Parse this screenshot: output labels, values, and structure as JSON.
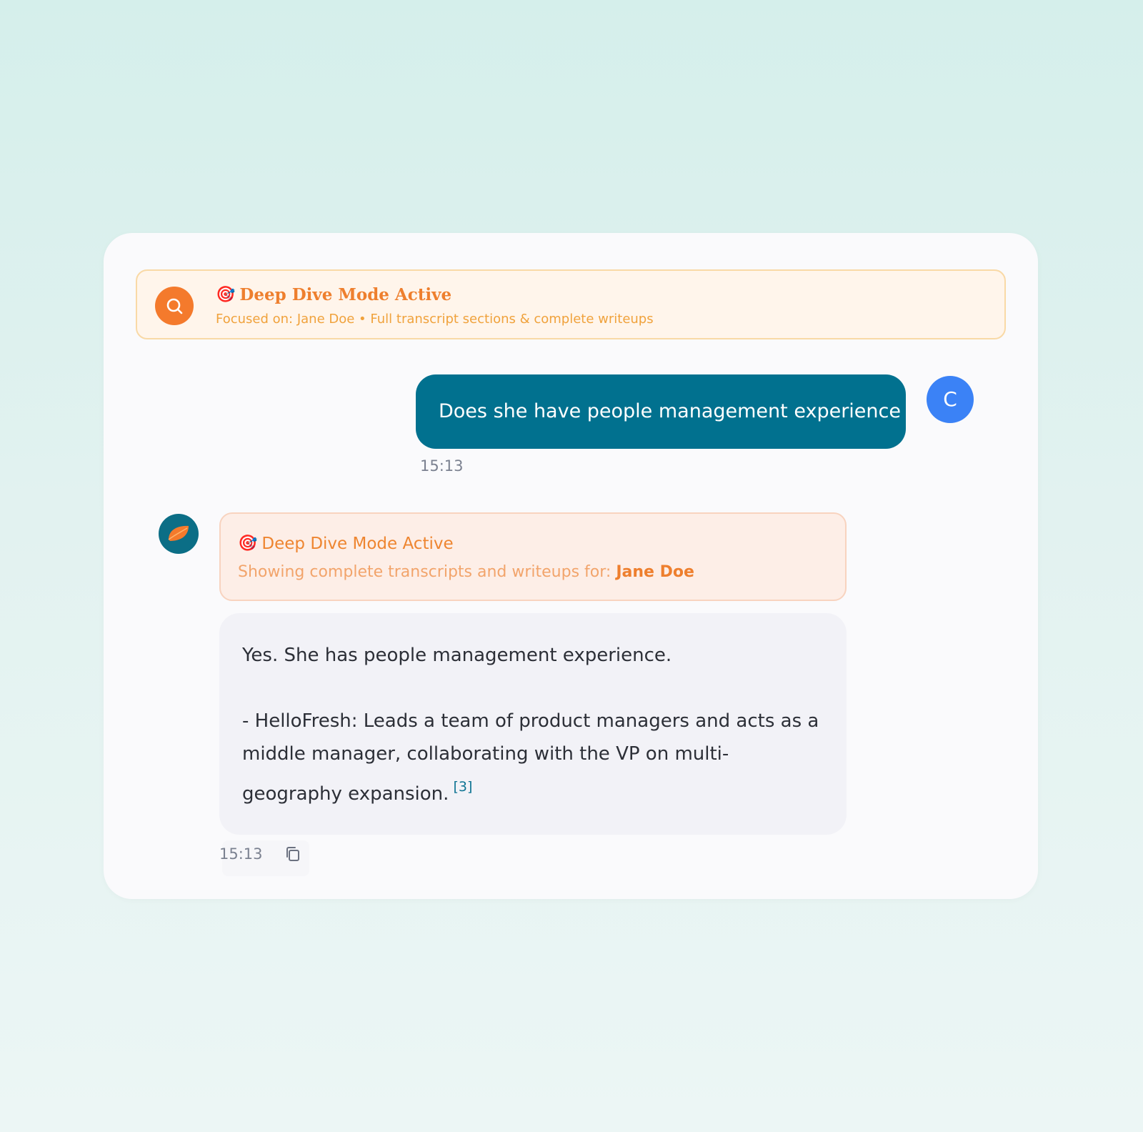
{
  "banner": {
    "icon": "search-icon",
    "emoji": "🎯",
    "title": "Deep Dive Mode Active",
    "subtitle": "Focused on: Jane Doe • Full transcript sections & complete writeups",
    "accent": "#f47a2c"
  },
  "user_message": {
    "text": "Does she have people management experience",
    "time": "15:13",
    "avatar_initial": "C",
    "bubble_color": "#01718f",
    "avatar_color": "#3b82f6"
  },
  "assistant": {
    "avatar_icon": "leaf-logo-icon",
    "mode_banner": {
      "emoji": "🎯",
      "title": "Deep Dive Mode Active",
      "subtitle_prefix": "Showing complete transcripts and writeups for: ",
      "subtitle_name": "Jane Doe"
    },
    "answer": {
      "line1": "Yes. She has people management experience.",
      "bullet": "- HelloFresh: Leads a team of product managers and acts as a middle manager, collaborating with the VP on multi-geography expansion.",
      "citation": "[3]"
    },
    "time": "15:13",
    "copy_icon": "copy-icon"
  }
}
